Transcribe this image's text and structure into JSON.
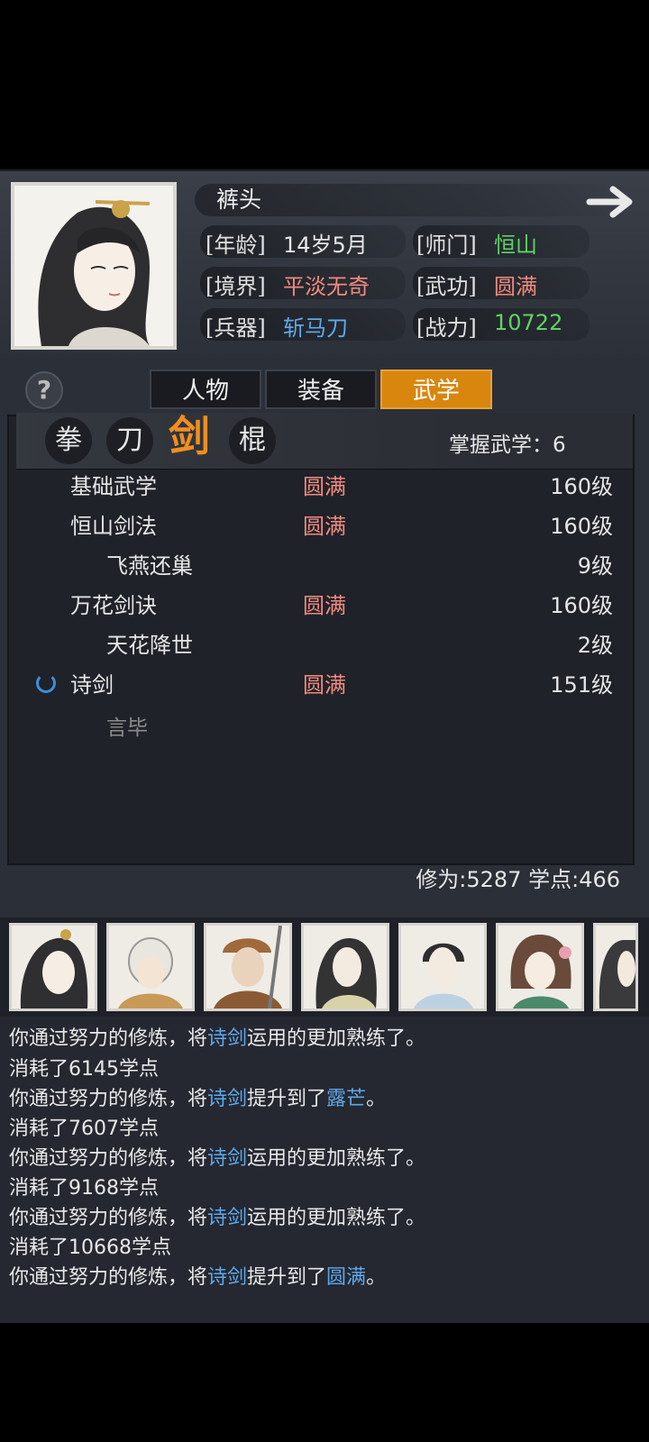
{
  "character": {
    "name": "裤头",
    "age_label": "[年龄]",
    "age": "14岁5月",
    "sect_label": "[师门]",
    "sect": "恒山",
    "realm_label": "[境界]",
    "realm": "平淡无奇",
    "martial_label": "[武功]",
    "martial": "圆满",
    "weapon_label": "[兵器]",
    "weapon": "斩马刀",
    "power_label": "[战力]",
    "power": "10722"
  },
  "help_icon": "?",
  "tabs": [
    {
      "label": "人物",
      "active": false
    },
    {
      "label": "装备",
      "active": false
    },
    {
      "label": "武学",
      "active": true
    }
  ],
  "categories": [
    {
      "label": "拳",
      "active": false
    },
    {
      "label": "刀",
      "active": false
    },
    {
      "label": "剑",
      "active": true
    },
    {
      "label": "棍",
      "active": false
    }
  ],
  "mastered": "掌握武学：6",
  "skills": [
    {
      "name": "基础武学",
      "status": "圆满",
      "level": "160级",
      "sub": false
    },
    {
      "name": "恒山剑法",
      "status": "圆满",
      "level": "160级",
      "sub": false
    },
    {
      "name": "飞燕还巢",
      "status": "",
      "level": "9级",
      "sub": true
    },
    {
      "name": "万花剑诀",
      "status": "圆满",
      "level": "160级",
      "sub": false
    },
    {
      "name": "天花降世",
      "status": "",
      "level": "2级",
      "sub": true
    },
    {
      "name": "诗剑",
      "status": "圆满",
      "level": "151级",
      "sub": false
    }
  ],
  "closing_text": "言毕",
  "stats": "修为:5287  学点:466",
  "log": [
    {
      "text": "你通过努力的修炼，将",
      "hl": "诗剑",
      "rest": "运用的更加熟练了。"
    },
    {
      "text": "消耗了6145学点",
      "hl": "",
      "rest": ""
    },
    {
      "text": "你通过努力的修炼，将",
      "hl": "诗剑",
      "rest": "提升到了",
      "hl2": "露芒",
      "end": "。"
    },
    {
      "text": "消耗了7607学点",
      "hl": "",
      "rest": ""
    },
    {
      "text": "你通过努力的修炼，将",
      "hl": "诗剑",
      "rest": "运用的更加熟练了。"
    },
    {
      "text": "消耗了9168学点",
      "hl": "",
      "rest": ""
    },
    {
      "text": "你通过努力的修炼，将",
      "hl": "诗剑",
      "rest": "运用的更加熟练了。"
    },
    {
      "text": "消耗了10668学点",
      "hl": "",
      "rest": ""
    },
    {
      "text": "你通过努力的修炼，将",
      "hl": "诗剑",
      "rest": "提升到了",
      "hl2": "圆满",
      "end": "。"
    }
  ],
  "colors": {
    "accent": "#d9860f",
    "positive": "#5fd363",
    "status": "#f08a7e",
    "link": "#5ea8ea"
  }
}
